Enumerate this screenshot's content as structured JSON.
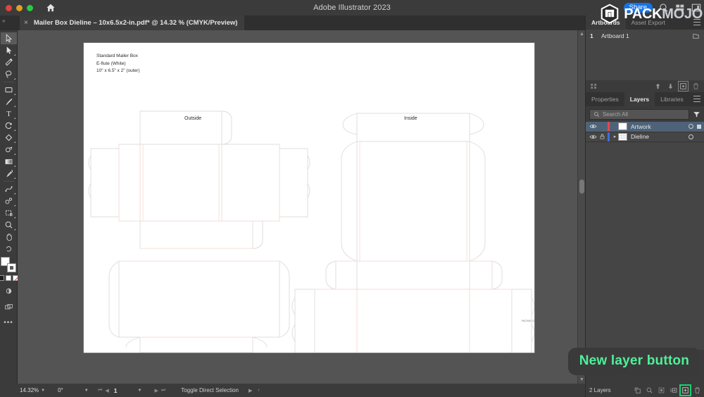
{
  "titlebar": {
    "app_title": "Adobe Illustrator 2023",
    "share_label": "Share",
    "icons": [
      "home-icon",
      "search-icon",
      "arrange-documents-icon",
      "workspace-switcher-icon"
    ]
  },
  "watermark": {
    "text_primary": "PACK",
    "text_secondary": "MOJO",
    "logo": "packmojo-logo-icon"
  },
  "tab": {
    "close_label": "×",
    "title": "Mailer Box Dieline – 10x6.5x2-in.pdf* @ 14.32 % (CMYK/Preview)"
  },
  "toolbar": {
    "tools": [
      {
        "name": "selection-tool",
        "selected": true
      },
      {
        "name": "direct-selection-tool",
        "selected": false
      },
      {
        "name": "magic-wand-tool",
        "selected": false
      },
      {
        "name": "lasso-tool",
        "selected": false
      },
      {
        "name": "rectangle-tool",
        "selected": false
      },
      {
        "name": "paintbrush-tool",
        "selected": false
      },
      {
        "name": "type-tool",
        "selected": false
      },
      {
        "name": "rotate-tool",
        "selected": false
      },
      {
        "name": "gradient-mesh-tool",
        "selected": false
      },
      {
        "name": "shape-builder-tool",
        "selected": false
      },
      {
        "name": "gradient-tool",
        "selected": false
      },
      {
        "name": "eyedropper-tool",
        "selected": false
      },
      {
        "name": "blend-tool",
        "selected": false
      },
      {
        "name": "symbol-sprayer-tool",
        "selected": false
      },
      {
        "name": "artboard-tool",
        "selected": false
      },
      {
        "name": "zoom-tool",
        "selected": false
      },
      {
        "name": "hand-tool",
        "selected": false
      }
    ],
    "fill_color": "#ffffff",
    "stroke_color": "#ffffff",
    "more_tools_label": "•••"
  },
  "artboard": {
    "spec_lines": [
      "Standard Mailer Box",
      "E-flute (White)",
      "10\" x 6.5\" x 2\" (outer)"
    ],
    "label_outside": "Outside",
    "label_inside": "Inside",
    "tiny_mark": "PACKMOJO",
    "dieline_cut_color": "#d9d9d9",
    "dieline_crease_color": "#f3d4cf",
    "background": "#ffffff"
  },
  "statusbar": {
    "zoom_level": "14.32%",
    "rotation": "0°",
    "artboard_number": "1",
    "status_text": "Toggle Direct Selection",
    "nav_first": "⏮",
    "nav_prev": "◀",
    "nav_next": "▶",
    "nav_last": "⏭",
    "forward_arrow": "▶",
    "back_arrow": "‹"
  },
  "artboards_panel": {
    "tabs": [
      {
        "label": "Artboards",
        "active": true
      },
      {
        "label": "Asset Export",
        "active": false
      }
    ],
    "rows": [
      {
        "index": "1",
        "name": "Artboard 1"
      }
    ],
    "footer_icons": [
      "rearrange-artboards-icon",
      "move-up-icon",
      "move-down-icon",
      "new-artboard-icon",
      "delete-artboard-icon"
    ]
  },
  "layers_panel": {
    "tabs": [
      {
        "label": "Properties",
        "active": false
      },
      {
        "label": "Layers",
        "active": true
      },
      {
        "label": "Libraries",
        "active": false
      }
    ],
    "search_placeholder": "Search All",
    "search_value": "",
    "filter_icon": "filter-funnel-icon",
    "layers": [
      {
        "name": "Artwork",
        "color": "#e8484a",
        "visible": true,
        "locked": false,
        "selected": true,
        "expandable": false
      },
      {
        "name": "Dieline",
        "color": "#3f6fd8",
        "visible": true,
        "locked": true,
        "selected": false,
        "expandable": true
      }
    ],
    "footer_count": "2 Layers",
    "footer_icons": [
      "locate-object-icon",
      "make-clipping-mask-icon",
      "create-new-sublayer-icon",
      "create-new-layer-icon",
      "delete-selection-icon"
    ]
  },
  "callout": {
    "text": "New layer button",
    "text_color": "#4ef09a",
    "background": "#3a3a3a"
  }
}
